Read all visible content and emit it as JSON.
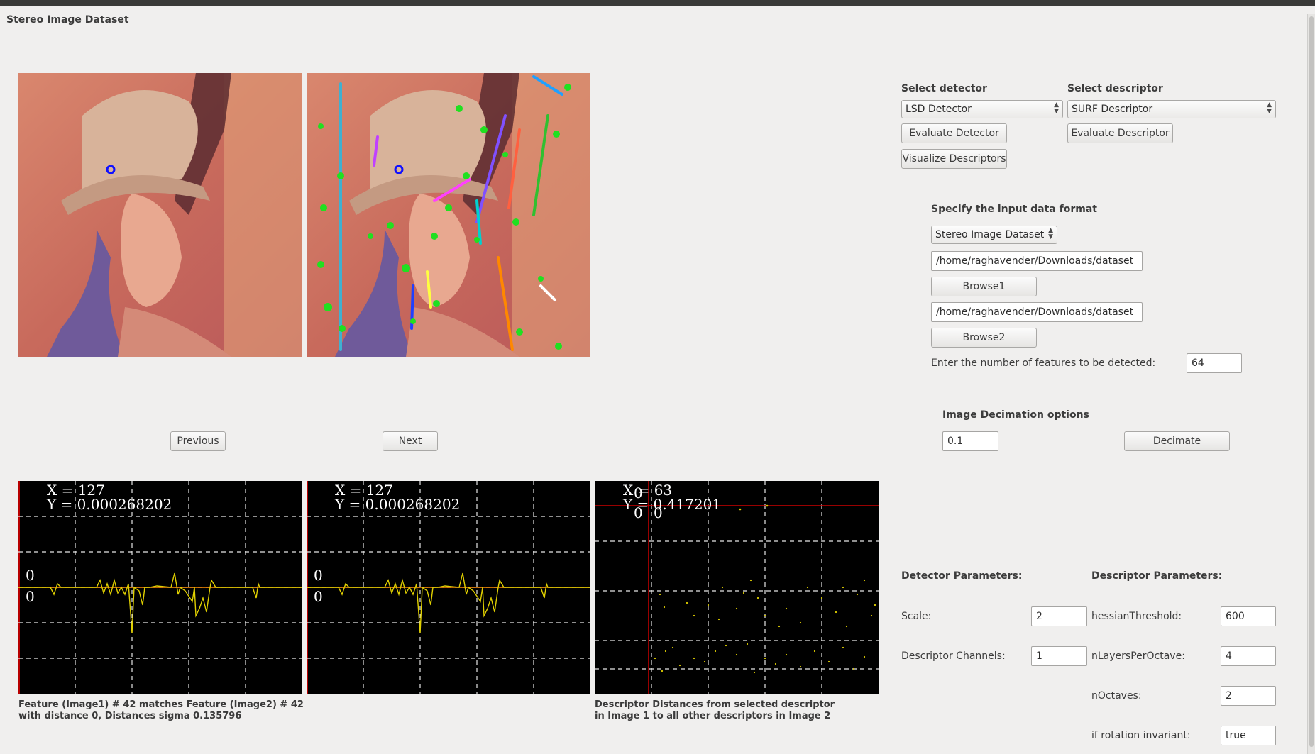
{
  "window": {
    "title": "Stereo Image Dataset"
  },
  "navigation": {
    "previous_label": "Previous",
    "next_label": "Next"
  },
  "detector": {
    "heading": "Select detector",
    "selected": "LSD Detector",
    "evaluate_label": "Evaluate Detector",
    "visualize_label": "Visualize Descriptors"
  },
  "descriptor": {
    "heading": "Select descriptor",
    "selected": "SURF Descriptor",
    "evaluate_label": "Evaluate Descriptor"
  },
  "input_format": {
    "heading": "Specify the input data format",
    "selected": "Stereo Image Dataset",
    "path1": "/home/raghavender/Downloads/dataset",
    "browse1_label": "Browse1",
    "path2": "/home/raghavender/Downloads/dataset",
    "browse2_label": "Browse2",
    "num_features_label": "Enter the number of features to be detected:",
    "num_features_value": "64"
  },
  "decimation": {
    "heading": "Image Decimation options",
    "value": "0.1",
    "button_label": "Decimate"
  },
  "plots": {
    "plot1": {
      "x_readout": "X = 127",
      "y_readout": "Y = 0.000268202",
      "zero_label_1": "0",
      "zero_label_2": "0"
    },
    "plot2": {
      "x_readout": "X = 127",
      "y_readout": "Y = 0.000268202",
      "zero_label_1": "0",
      "zero_label_2": "0"
    },
    "plot3": {
      "x_readout": "X = 63",
      "y_readout": "Y = 0.417201",
      "overlap_1": "0",
      "overlap_2": "0",
      "overlap_3": "0"
    }
  },
  "captions": {
    "match_line1": "Feature (Image1) # 42 matches Feature (Image2) # 42",
    "match_line2": "with distance 0, Distances sigma 0.135796",
    "dist_line1": "Descriptor Distances from selected descriptor",
    "dist_line2": "in Image 1 to all other descriptors in Image 2"
  },
  "detector_params": {
    "heading": "Detector Parameters:",
    "scale_label": "Scale:",
    "scale_value": "2",
    "channels_label": "Descriptor Channels:",
    "channels_value": "1"
  },
  "descriptor_params": {
    "heading": "Descriptor Parameters:",
    "hessian_label": "hessianThreshold:",
    "hessian_value": "600",
    "layers_label": "nLayersPerOctave:",
    "layers_value": "4",
    "octaves_label": "nOctaves:",
    "octaves_value": "2",
    "rotation_label": "if rotation invariant:",
    "rotation_value": "true"
  },
  "colors": {
    "plot_background": "#000000",
    "signal": "#e0d000",
    "zero_line": "#ff8c00",
    "crosshair": "#cc0000",
    "keypoint_marker": "#0000ff",
    "feature_lines": "#00ff00"
  },
  "icons": [
    "chevron-updown-icon",
    "scroll-thumb"
  ],
  "images": [
    "lena-original",
    "lena-with-line-features"
  ]
}
